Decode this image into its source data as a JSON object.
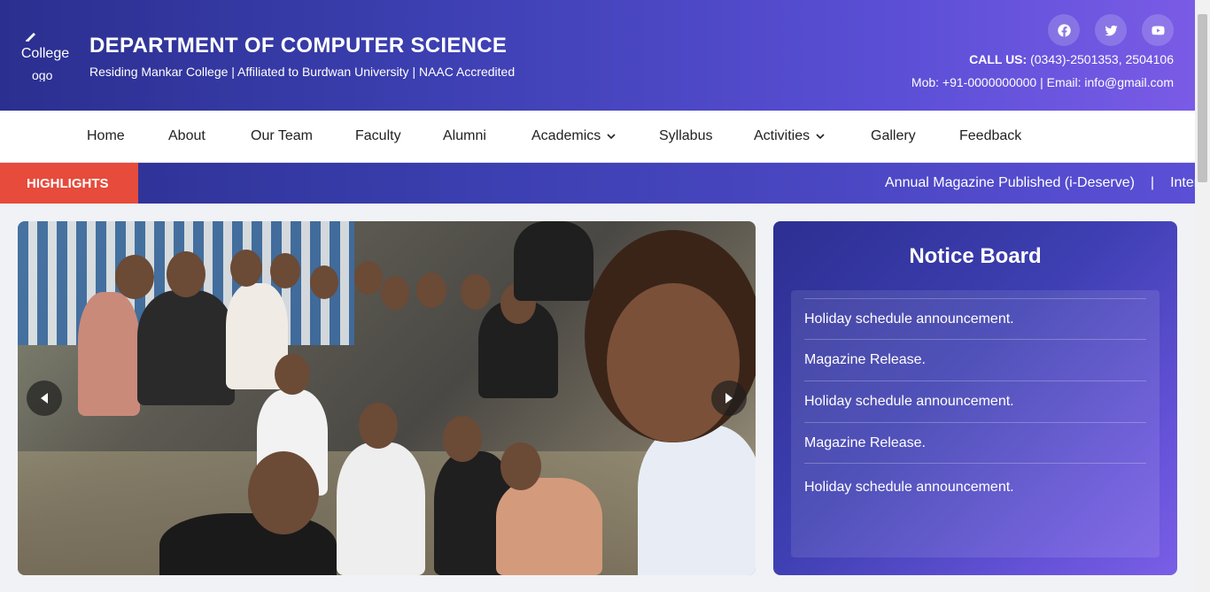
{
  "header": {
    "logo_alt": "College",
    "logo_alt_extra": "ogo",
    "title": "DEPARTMENT OF COMPUTER SCIENCE",
    "subtitle": "Residing Mankar College | Affiliated to Burdwan University | NAAC Accredited",
    "call_label": "CALL US:",
    "call_numbers": "(0343)-2501353, 2504106",
    "contact_line": "Mob: +91-0000000000 | Email: info@gmail.com",
    "socials": [
      "facebook-icon",
      "twitter-icon",
      "youtube-icon"
    ]
  },
  "nav": {
    "items": [
      "Home",
      "About",
      "Our Team",
      "Faculty",
      "Alumni",
      "Academics",
      "Syllabus",
      "Activities",
      "Gallery",
      "Feedback"
    ]
  },
  "highlights": {
    "label": "HIGHLIGHTS",
    "ticker_item": "Annual Magazine Published (i-Deserve)",
    "separator": "|",
    "ticker_next": "Inter"
  },
  "notice_board": {
    "title": "Notice Board",
    "items": [
      "Holiday schedule announcement.",
      "Magazine Release.",
      "Holiday schedule announcement.",
      "Magazine Release.",
      "Holiday schedule announcement."
    ]
  },
  "colors": {
    "header_start": "#2b2f8f",
    "header_end": "#7a5be6",
    "highlight_label": "#e64b3c"
  }
}
